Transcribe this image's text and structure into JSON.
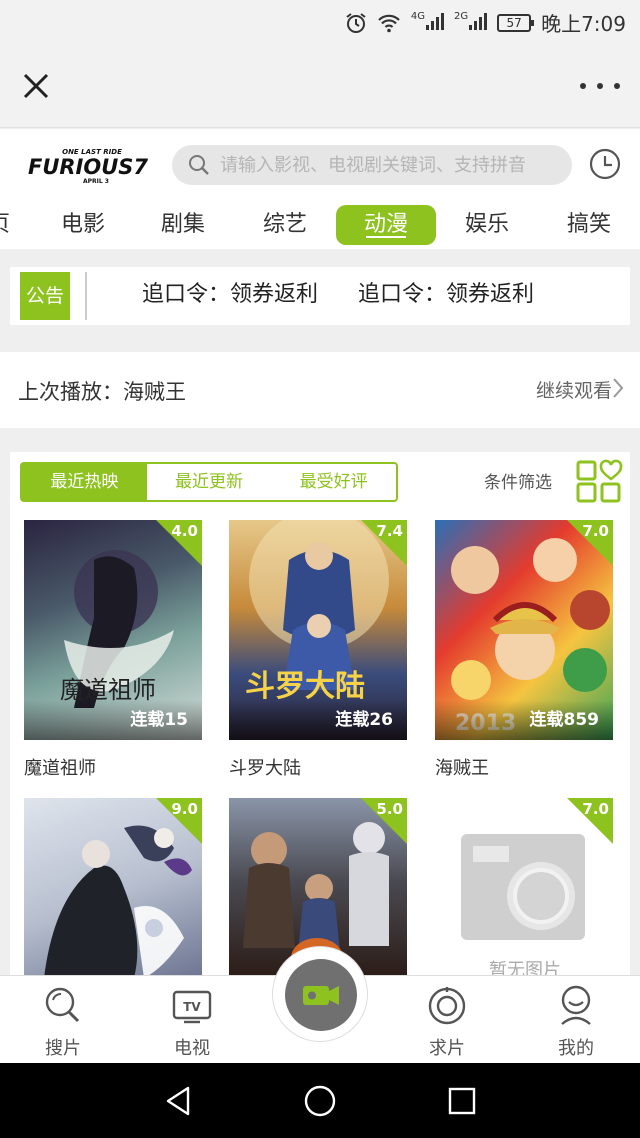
{
  "status_bar": {
    "net1": "4G",
    "net2": "2G",
    "battery": "57",
    "time": "晚上7:09"
  },
  "nav": {
    "close_icon": "close-icon",
    "more_icon": "more-icon"
  },
  "header": {
    "logo_line1": "ONE LAST RIDE",
    "logo_main": "FURIOUS7",
    "logo_line2": "APRIL 3",
    "search_placeholder": "请输入影视、电视剧关键词、支持拼音"
  },
  "categories": [
    "页",
    "电影",
    "剧集",
    "综艺",
    "动漫",
    "娱乐",
    "搞笑"
  ],
  "active_category": "动漫",
  "notice": {
    "badge": "公告",
    "items": [
      "追口令：领券返利",
      "追口令：领券返利"
    ]
  },
  "last_played": {
    "label": "上次播放：海贼王",
    "continue": "继续观看"
  },
  "sort_tabs": [
    "最近热映",
    "最近更新",
    "最受好评"
  ],
  "filter_label": "条件筛选",
  "items": [
    {
      "title": "魔道祖师",
      "rating": "4.0",
      "episodes": "连载15",
      "poster_text": "魔道祖师"
    },
    {
      "title": "斗罗大陆",
      "rating": "7.4",
      "episodes": "连载26",
      "poster_text": "斗罗大陆"
    },
    {
      "title": "海贼王",
      "rating": "7.0",
      "episodes": "连载859",
      "poster_text": "2013"
    },
    {
      "title": "",
      "rating": "9.0",
      "episodes": "",
      "poster_text": ""
    },
    {
      "title": "",
      "rating": "5.0",
      "episodes": "",
      "poster_text": ""
    },
    {
      "title": "",
      "rating": "7.0",
      "episodes": "",
      "poster_text": "暂无图片"
    }
  ],
  "tabbar": {
    "search": "搜片",
    "tv": "电视",
    "tv_icon_text": "TV",
    "request": "求片",
    "mine": "我的"
  },
  "colors": {
    "accent": "#8dc21f",
    "camera": "#707070"
  }
}
